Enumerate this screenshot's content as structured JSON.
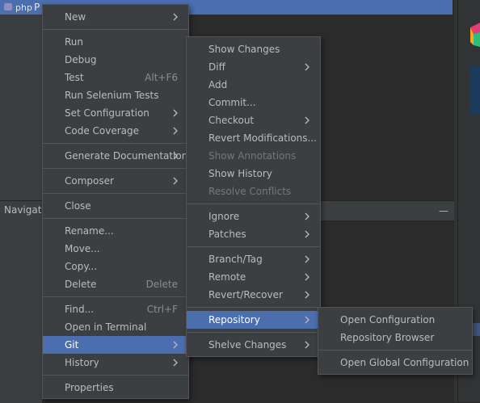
{
  "ide": {
    "selected_node_label": "php",
    "selected_node_suffix": "P",
    "navigator_label": "Navigato",
    "minimize_glyph": "—"
  },
  "context_menu": {
    "items": [
      {
        "label": "New",
        "submenu": true
      },
      {
        "label": "Run"
      },
      {
        "label": "Debug"
      },
      {
        "label": "Test",
        "shortcut": "Alt+F6"
      },
      {
        "label": "Run Selenium Tests"
      },
      {
        "label": "Set Configuration",
        "submenu": true
      },
      {
        "label": "Code Coverage",
        "submenu": true
      },
      {
        "label": "Generate Documentation",
        "submenu": true
      },
      {
        "label": "Composer",
        "submenu": true
      },
      {
        "label": "Close"
      },
      {
        "label": "Rename..."
      },
      {
        "label": "Move..."
      },
      {
        "label": "Copy..."
      },
      {
        "label": "Delete",
        "shortcut": "Delete"
      },
      {
        "label": "Find...",
        "shortcut": "Ctrl+F"
      },
      {
        "label": "Open in Terminal"
      },
      {
        "label": "Git",
        "submenu": true,
        "selected": true
      },
      {
        "label": "History",
        "submenu": true
      },
      {
        "label": "Properties"
      }
    ]
  },
  "git_menu": {
    "items": [
      {
        "label": "Show Changes"
      },
      {
        "label": "Diff",
        "submenu": true
      },
      {
        "label": "Add"
      },
      {
        "label": "Commit..."
      },
      {
        "label": "Checkout",
        "submenu": true
      },
      {
        "label": "Revert Modifications..."
      },
      {
        "label": "Show Annotations",
        "disabled": true
      },
      {
        "label": "Show History"
      },
      {
        "label": "Resolve Conflicts",
        "disabled": true
      },
      {
        "label": "Ignore",
        "submenu": true
      },
      {
        "label": "Patches",
        "submenu": true
      },
      {
        "label": "Branch/Tag",
        "submenu": true
      },
      {
        "label": "Remote",
        "submenu": true
      },
      {
        "label": "Revert/Recover",
        "submenu": true
      },
      {
        "label": "Repository",
        "submenu": true,
        "selected": true
      },
      {
        "label": "Shelve Changes",
        "submenu": true
      }
    ]
  },
  "repository_menu": {
    "items": [
      {
        "label": "Open Configuration"
      },
      {
        "label": "Repository Browser"
      },
      {
        "label": "Open Global Configuration"
      }
    ]
  },
  "colors": {
    "menu_bg": "#3c3f41",
    "selection": "#4b6eaf",
    "text": "#bbbbbb",
    "disabled_text": "#777777"
  }
}
